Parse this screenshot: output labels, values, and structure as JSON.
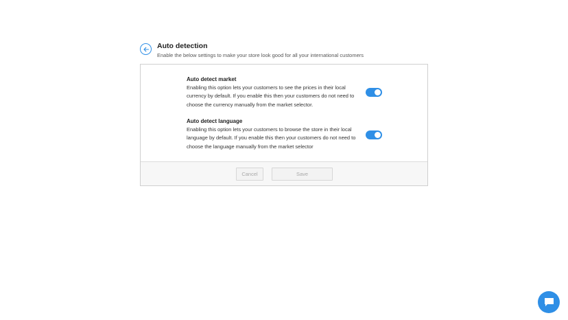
{
  "header": {
    "title": "Auto detection",
    "subtitle": "Enable the below settings to make your store look good for all your international customers",
    "back_icon": "arrow-left-icon"
  },
  "settings": [
    {
      "title": "Auto detect market",
      "description": "Enabling this option lets your customers to see the prices in their local currency by default. If you enable this then your customers do not need to choose the currency manually from the market selector.",
      "enabled": true
    },
    {
      "title": "Auto detect language",
      "description": "Enabling this option lets your customers to browse the store in their local language by default. If you enable this then your customers do not need to choose the language manually from the market selector",
      "enabled": true
    }
  ],
  "footer": {
    "cancel_label": "Cancel",
    "save_label": "Save"
  },
  "chat": {
    "icon": "chat-bubble-icon"
  },
  "colors": {
    "accent": "#2f8fe6",
    "border": "#cfcfcf",
    "footer_bg": "#f7f7f7",
    "disabled_text": "#a8a8a8"
  }
}
